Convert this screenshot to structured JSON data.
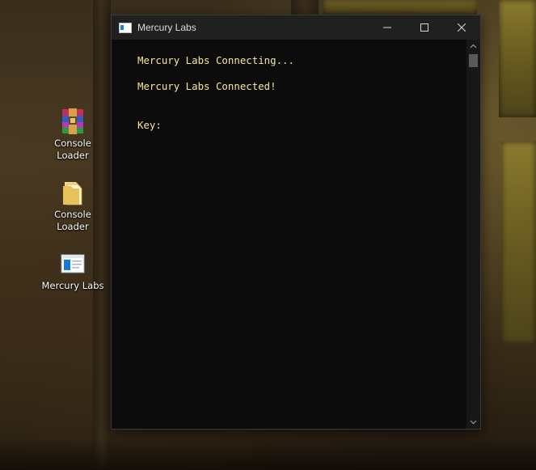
{
  "desktop": {
    "icons": [
      {
        "label": "Console\nLoader",
        "icon": "winrar-archive-icon"
      },
      {
        "label": "Console\nLoader",
        "icon": "folder-icon"
      },
      {
        "label": "Mercury Labs",
        "icon": "console-app-icon"
      }
    ]
  },
  "window": {
    "title": "Mercury Labs",
    "minimize_icon": "minimize-icon",
    "maximize_icon": "maximize-icon",
    "close_icon": "close-icon",
    "console": {
      "text_color": "#f2e79b",
      "background": "#0c0c0c",
      "lines": [
        "Mercury Labs Connecting...",
        "Mercury Labs Connected!",
        "Key:"
      ]
    }
  }
}
